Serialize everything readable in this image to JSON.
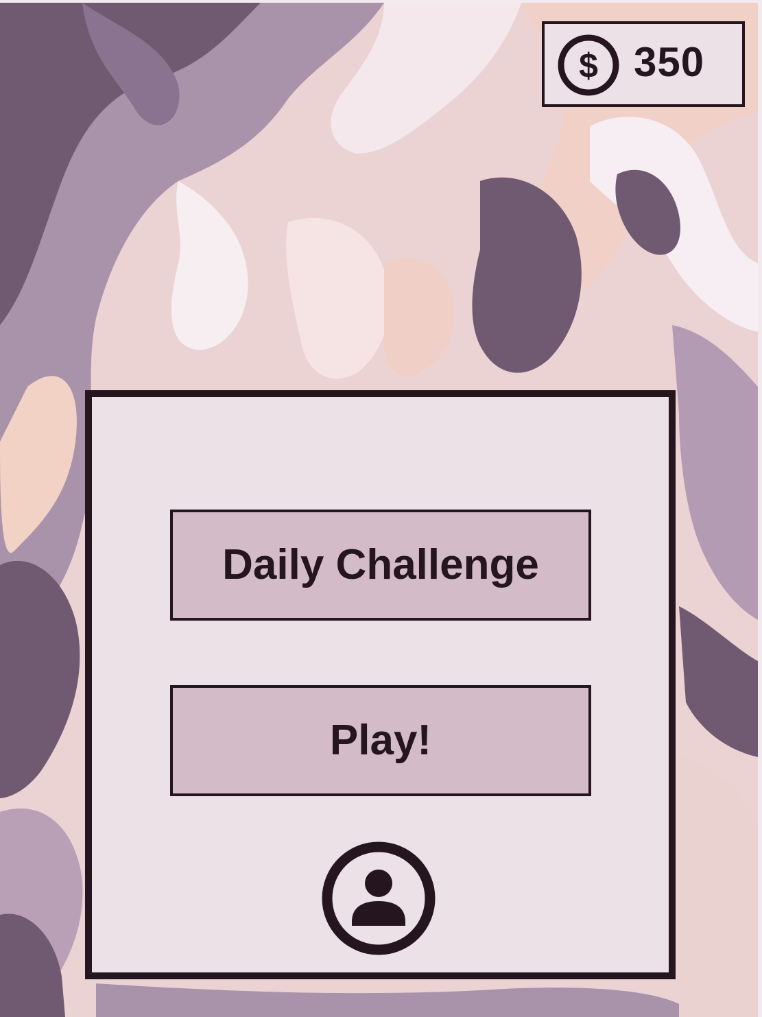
{
  "currency": {
    "icon": "dollar-coin-icon",
    "amount": "350"
  },
  "menu": {
    "daily_challenge_label": "Daily Challenge",
    "play_label": "Play!",
    "profile_icon": "user-profile-icon"
  },
  "colors": {
    "ink": "#24151f",
    "panel": "#ede1e8",
    "button": "#d3bcc7",
    "marble_dark": "#6b5670",
    "marble_mid": "#a890a8",
    "marble_peach": "#f3d3cb"
  }
}
